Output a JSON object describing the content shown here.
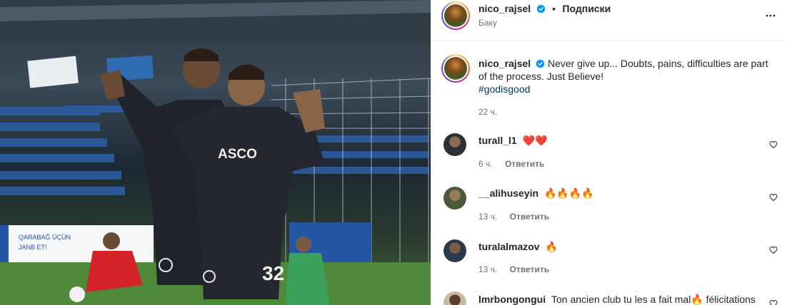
{
  "post": {
    "username": "nico_rajsel",
    "follow_separator": "•",
    "follow_label": "Подписки",
    "location": "Баку",
    "caption_text": "Never give up... Doubts, pains, difficulties are part of the process. Just Believe!",
    "hashtag": "#godisgood",
    "caption_time": "22 ч.",
    "photo_texts": {
      "sponsor_logo": "ASCO",
      "banner": "QARABAĞ ÜÇÜN\nJANB ET!",
      "jersey_number": "32"
    }
  },
  "comments": [
    {
      "username": "turall_l1",
      "text": "❤️❤️",
      "time": "6 ч.",
      "reply": "Ответить"
    },
    {
      "username": "__alihuseyin",
      "text": "🔥🔥🔥🔥",
      "time": "13 ч.",
      "reply": "Ответить"
    },
    {
      "username": "turalalmazov",
      "text": "🔥",
      "time": "13 ч.",
      "reply": "Ответить"
    },
    {
      "username": "lmrbongongui",
      "text": "Ton ancien club tu les a fait mal🔥 félicitations",
      "time": "",
      "reply": ""
    }
  ],
  "icons": {
    "verified": "verified-badge-icon",
    "more": "more-options-icon",
    "like": "heart-outline-icon"
  },
  "colors": {
    "verified_blue": "#0095f6",
    "hashtag": "#00376b",
    "secondary_text": "#737373",
    "border": "#efefef"
  }
}
